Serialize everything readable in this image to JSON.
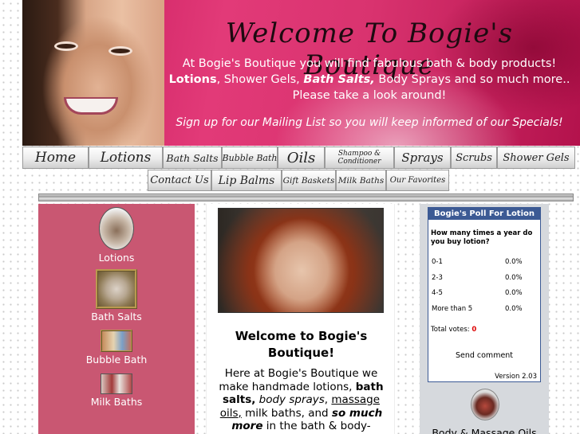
{
  "banner": {
    "title": "Welcome To Bogie's Boutique",
    "line1": "At Bogie's Boutique you will find fabulous bath & body products!",
    "line2_a": "Lotions",
    "line2_b": ", Shower Gels, ",
    "line2_c": "Bath Salts,",
    "line2_d": " Body Sprays and so much more..",
    "line3": "Please take a look around!",
    "mailing": "Sign up for our Mailing List so you will keep informed of our Specials!"
  },
  "nav": {
    "row1": [
      "Home",
      "Lotions",
      "Bath Salts",
      "Bubble Bath",
      "Oils",
      "Shampoo & Conditioner",
      "Sprays",
      "Scrubs",
      "Shower Gels"
    ],
    "row2": [
      "Contact Us",
      "Lip Balms",
      "Gift Baskets",
      "Milk Baths",
      "Our Favorites"
    ]
  },
  "sidebar": {
    "items": [
      "Lotions",
      "Bath Salts",
      "Bubble Bath",
      "Milk Baths"
    ]
  },
  "main": {
    "welcome_title": "Welcome to Bogie's Boutique!",
    "p_a": "Here at Bogie's Boutique we make handmade lotions, ",
    "p_b": "bath salts,",
    "p_c": " ",
    "p_d": "body sprays",
    "p_e": ", ",
    "p_f": "massage oils,",
    "p_g": " milk baths, and ",
    "p_h": "so much more",
    "p_i": " in the bath & body-beauty area."
  },
  "poll": {
    "header": "Bogie's Poll For Lotion",
    "question": "How many times a year do you buy lotion?",
    "options": [
      {
        "label": "0-1",
        "pct": "0.0%"
      },
      {
        "label": "2-3",
        "pct": "0.0%"
      },
      {
        "label": "4-5",
        "pct": "0.0%"
      },
      {
        "label": "More than 5",
        "pct": "0.0%"
      }
    ],
    "votes_label": "Total votes:",
    "votes_value": "0",
    "send": "Send comment",
    "version": "Version 2.03"
  },
  "right": {
    "oil_label": "Body & Massage Oils"
  },
  "colors": {
    "banner_pink": "#d9336f",
    "sidebar_rose": "#c95772",
    "poll_blue": "#3c5a94"
  }
}
